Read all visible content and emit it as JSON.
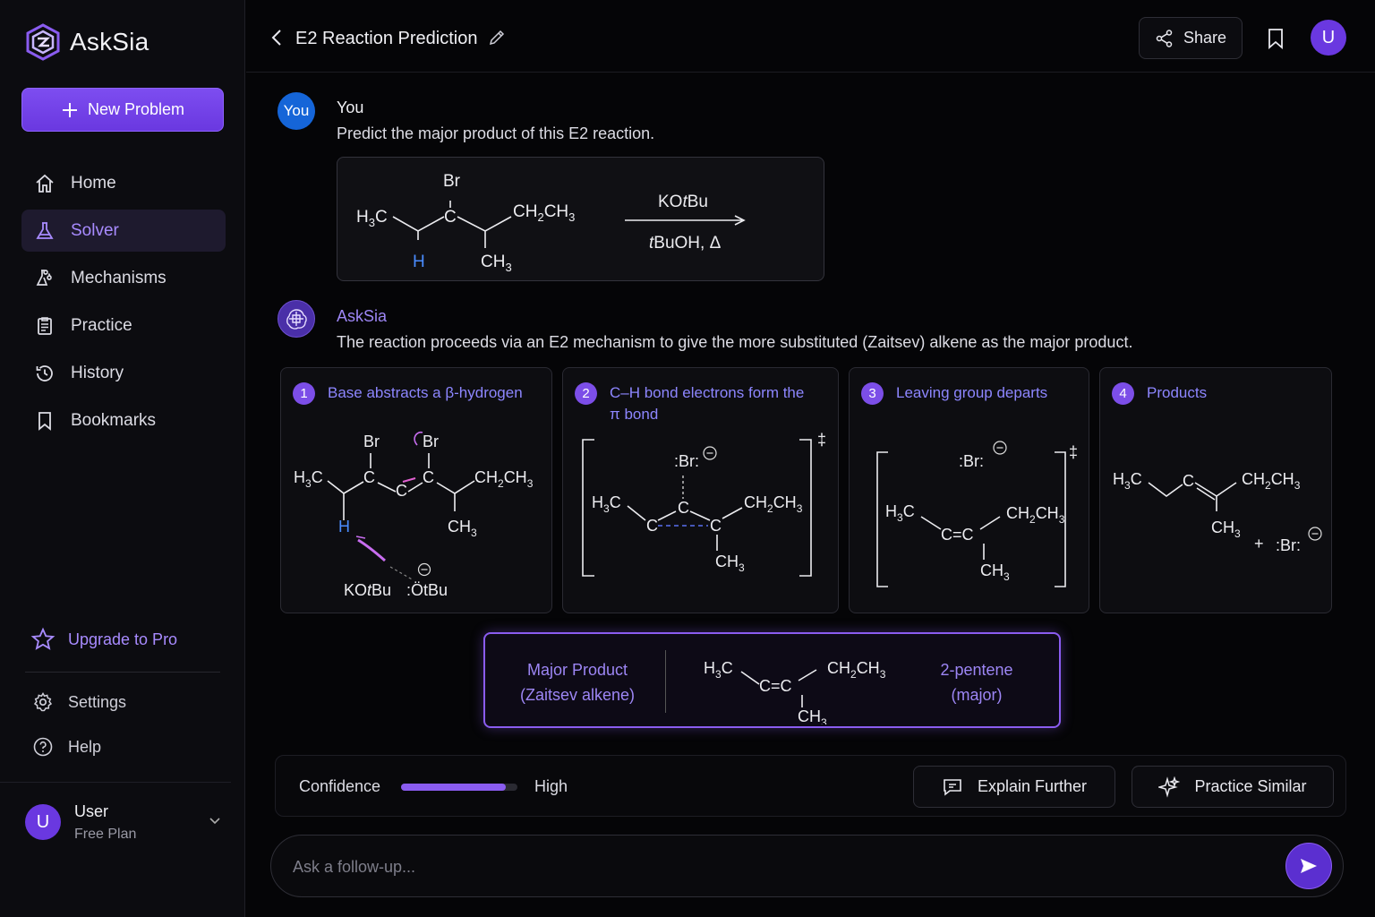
{
  "app": {
    "name": "AskSia",
    "logo_icon": "hexagon-logo-icon"
  },
  "sidebar": {
    "new_problem_label": "New Problem",
    "nav": [
      {
        "label": "Home",
        "icon": "home-icon",
        "active": false
      },
      {
        "label": "Solver",
        "icon": "flask-icon",
        "active": true
      },
      {
        "label": "Mechanisms",
        "icon": "molecule-icon",
        "active": false
      },
      {
        "label": "Practice",
        "icon": "clipboard-icon",
        "active": false
      },
      {
        "label": "History",
        "icon": "history-icon",
        "active": false
      },
      {
        "label": "Bookmarks",
        "icon": "bookmark-icon",
        "active": false
      }
    ],
    "upgrade_label": "Upgrade to Pro",
    "settings_label": "Settings",
    "help_label": "Help",
    "user": {
      "initial": "U",
      "name": "User",
      "plan": "Free Plan"
    }
  },
  "header": {
    "title": "E2 Reaction Prediction",
    "share_label": "Share",
    "avatar_initial": "U"
  },
  "user_message": {
    "avatar": "You",
    "sender": "You",
    "text": "Predict the major product of this E2 reaction.",
    "reagent": "KOtBu",
    "conditions": "tBuOH, Δ"
  },
  "assistant_message": {
    "sender": "AskSia",
    "text": "The reaction proceeds via an E2 mechanism to give the more substituted (Zaitsev) alkene as the major product.",
    "steps": [
      {
        "num": "1",
        "title": "Base abstracts a β-hydrogen"
      },
      {
        "num": "2",
        "title": "C–H bond electrons form the π bond"
      },
      {
        "num": "3",
        "title": "Leaving group departs"
      },
      {
        "num": "4",
        "title": "Products"
      }
    ],
    "major_product": {
      "label_line1": "Major Product",
      "label_line2": "(Zaitsev alkene)",
      "name_line1": "2-pentene",
      "name_line2": "(major)"
    }
  },
  "confidence": {
    "label": "Confidence",
    "value": "High",
    "level": 0.9,
    "color": "#8a5cf0"
  },
  "actions": {
    "explain_label": "Explain Further",
    "practice_label": "Practice Similar"
  },
  "composer": {
    "placeholder": "Ask a follow-up..."
  },
  "colors": {
    "accent": "#7c4ee8",
    "accent_light": "#a88bff",
    "user_avatar": "#1565d8",
    "step_title": "#8d86ff"
  }
}
